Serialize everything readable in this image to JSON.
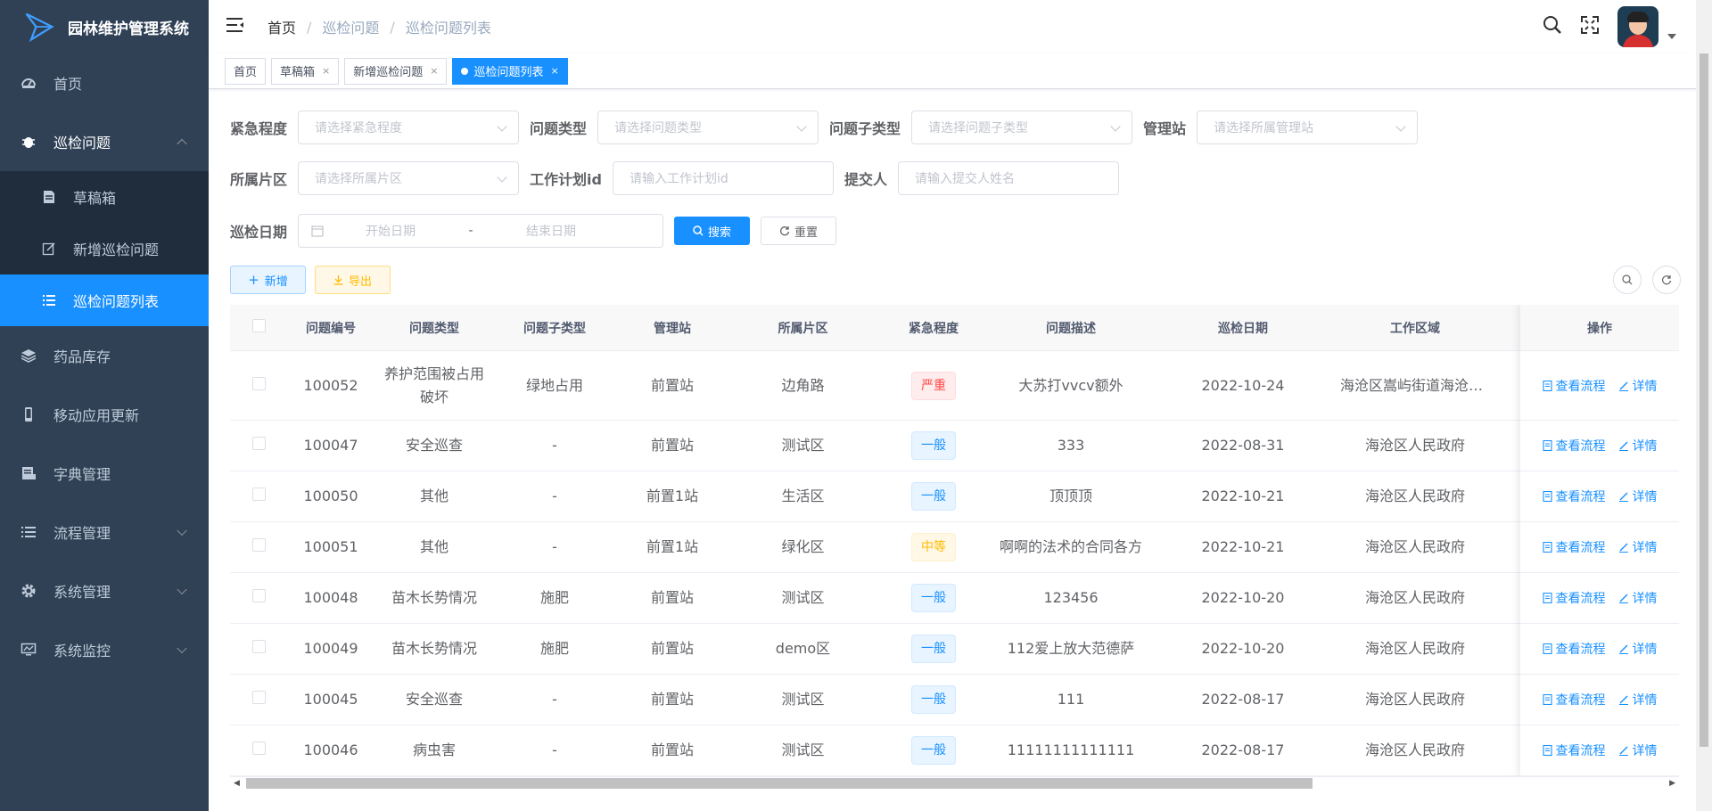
{
  "app": {
    "title": "园林维护管理系统"
  },
  "sidebar": {
    "items": [
      {
        "label": "首页",
        "icon": "dashboard-icon"
      },
      {
        "label": "巡检问题",
        "icon": "bug-icon",
        "open": true,
        "children": [
          {
            "label": "草稿箱",
            "icon": "document-icon"
          },
          {
            "label": "新增巡检问题",
            "icon": "edit-icon"
          },
          {
            "label": "巡检问题列表",
            "icon": "list-icon",
            "active": true
          }
        ]
      },
      {
        "label": "药品库存",
        "icon": "layers-icon"
      },
      {
        "label": "移动应用更新",
        "icon": "phone-icon"
      },
      {
        "label": "字典管理",
        "icon": "dict-icon"
      },
      {
        "label": "流程管理",
        "icon": "list-icon"
      },
      {
        "label": "系统管理",
        "icon": "gear-icon"
      },
      {
        "label": "系统监控",
        "icon": "monitor-icon"
      }
    ]
  },
  "breadcrumb": [
    "首页",
    "巡检问题",
    "巡检问题列表"
  ],
  "tags": [
    "首页",
    "草稿箱",
    "新增巡检问题",
    "巡检问题列表"
  ],
  "form": {
    "urgency": {
      "label": "紧急程度",
      "placeholder": "请选择紧急程度"
    },
    "problem_type": {
      "label": "问题类型",
      "placeholder": "请选择问题类型"
    },
    "problem_subtype": {
      "label": "问题子类型",
      "placeholder": "请选择问题子类型"
    },
    "station": {
      "label": "管理站",
      "placeholder": "请选择所属管理站"
    },
    "area": {
      "label": "所属片区",
      "placeholder": "请选择所属片区"
    },
    "plan_id": {
      "label": "工作计划id",
      "placeholder": "请输入工作计划id"
    },
    "submitter": {
      "label": "提交人",
      "placeholder": "请输入提交人姓名"
    },
    "date": {
      "label": "巡检日期",
      "start": "开始日期",
      "sep": "-",
      "end": "结束日期"
    },
    "search_btn": "搜索",
    "reset_btn": "重置"
  },
  "toolbar": {
    "add": "新增",
    "export": "导出"
  },
  "table": {
    "headers": [
      "问题编号",
      "问题类型",
      "问题子类型",
      "管理站",
      "所属片区",
      "紧急程度",
      "问题描述",
      "巡检日期",
      "工作区域",
      "操作"
    ],
    "rows": [
      {
        "id": "100052",
        "type": "养护范围被占用破坏",
        "subtype": "绿地占用",
        "station": "前置站",
        "area": "边角路",
        "urgency": "严重",
        "urgency_color": "red",
        "desc": "大苏打vvcv额外",
        "date": "2022-10-24",
        "region": "海沧区嵩屿街道海沧区..."
      },
      {
        "id": "100047",
        "type": "安全巡查",
        "subtype": "-",
        "station": "前置站",
        "area": "测试区",
        "urgency": "一般",
        "urgency_color": "blue",
        "desc": "333",
        "date": "2022-08-31",
        "region": "海沧区人民政府"
      },
      {
        "id": "100050",
        "type": "其他",
        "subtype": "-",
        "station": "前置1站",
        "area": "生活区",
        "urgency": "一般",
        "urgency_color": "blue",
        "desc": "顶顶顶",
        "date": "2022-10-21",
        "region": "海沧区人民政府"
      },
      {
        "id": "100051",
        "type": "其他",
        "subtype": "-",
        "station": "前置1站",
        "area": "绿化区",
        "urgency": "中等",
        "urgency_color": "yellow",
        "desc": "啊啊的法术的合同各方",
        "date": "2022-10-21",
        "region": "海沧区人民政府"
      },
      {
        "id": "100048",
        "type": "苗木长势情况",
        "subtype": "施肥",
        "station": "前置站",
        "area": "测试区",
        "urgency": "一般",
        "urgency_color": "blue",
        "desc": "123456",
        "date": "2022-10-20",
        "region": "海沧区人民政府"
      },
      {
        "id": "100049",
        "type": "苗木长势情况",
        "subtype": "施肥",
        "station": "前置站",
        "area": "demo区",
        "urgency": "一般",
        "urgency_color": "blue",
        "desc": "112爱上放大范德萨",
        "date": "2022-10-20",
        "region": "海沧区人民政府"
      },
      {
        "id": "100045",
        "type": "安全巡查",
        "subtype": "-",
        "station": "前置站",
        "area": "测试区",
        "urgency": "一般",
        "urgency_color": "blue",
        "desc": "111",
        "date": "2022-08-17",
        "region": "海沧区人民政府"
      },
      {
        "id": "100046",
        "type": "病虫害",
        "subtype": "-",
        "station": "前置站",
        "area": "测试区",
        "urgency": "一般",
        "urgency_color": "blue",
        "desc": "11111111111111",
        "date": "2022-08-17",
        "region": "海沧区人民政府"
      }
    ],
    "op_flow": "查看流程",
    "op_detail": "详情"
  },
  "colors": {
    "sidebar_bg": "#304156",
    "submenu_bg": "#1f2d3d",
    "accent": "#1890ff"
  }
}
